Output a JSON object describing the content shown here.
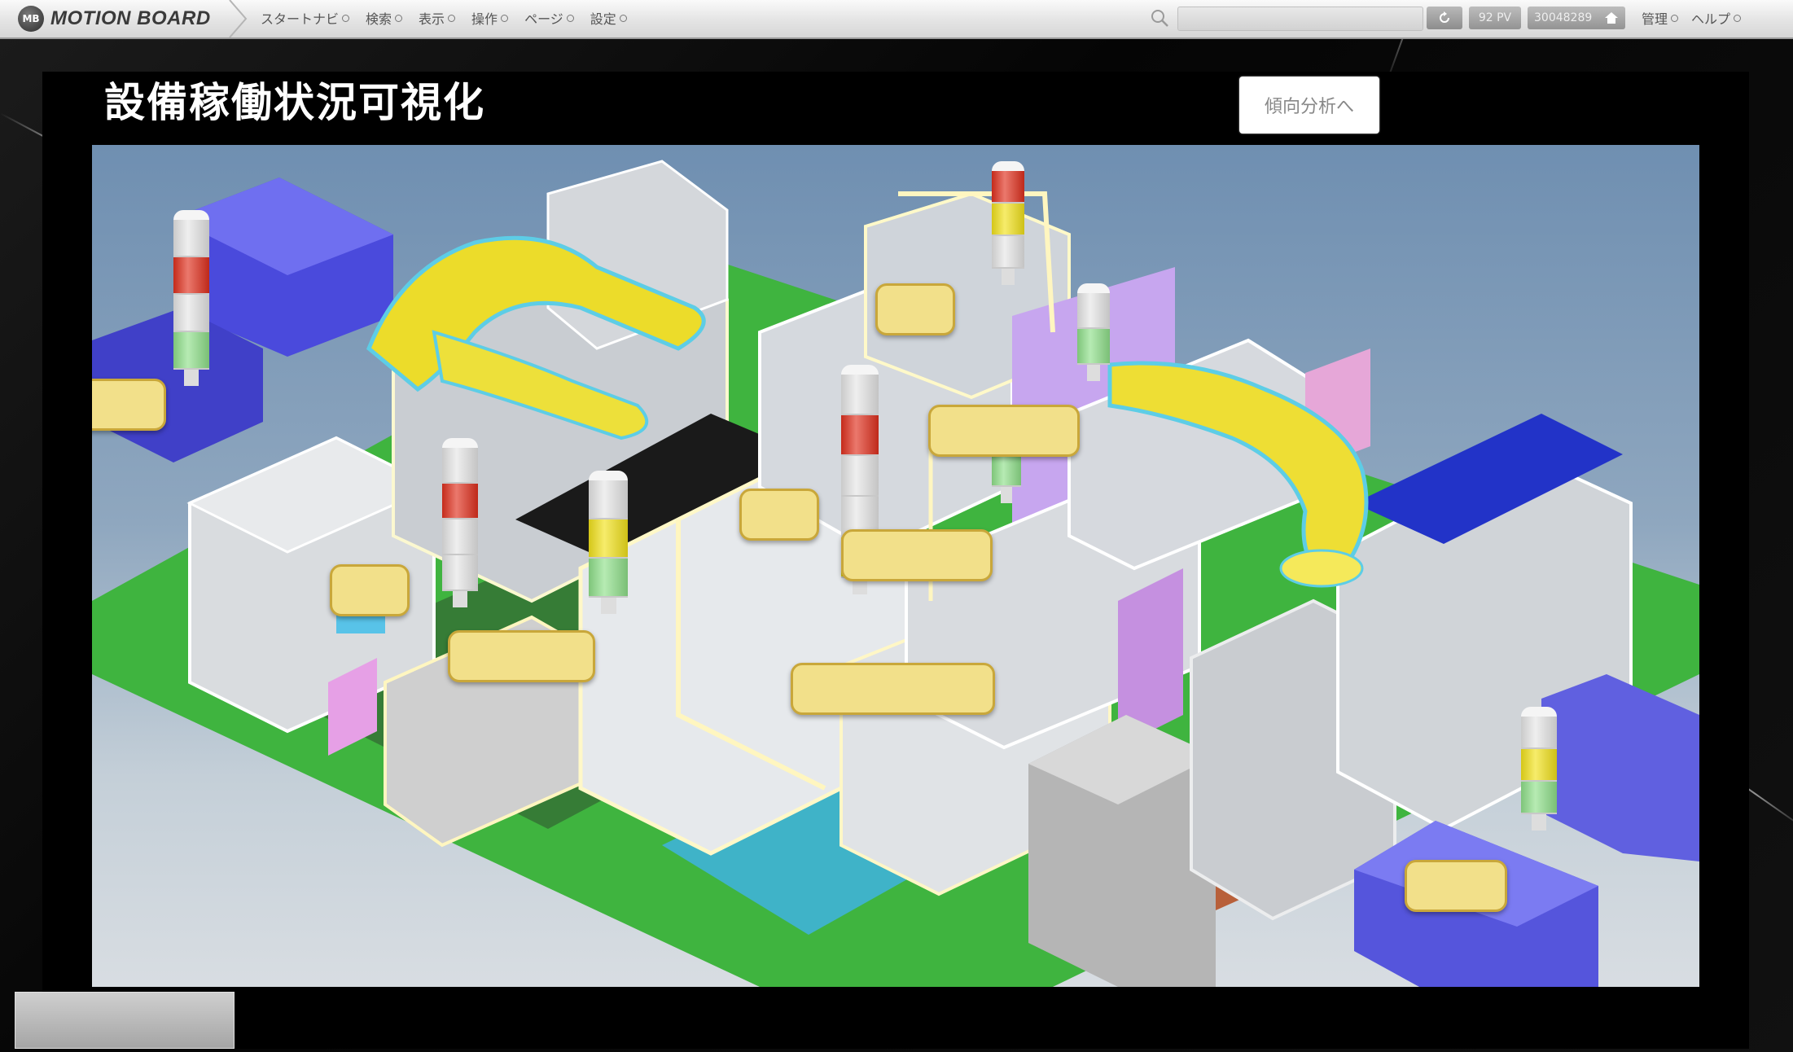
{
  "app": {
    "brand": "MotionBoard",
    "brand_display": "MOTION BOARD",
    "logo_letters": "MB"
  },
  "menu": [
    {
      "label": "スタートナビ"
    },
    {
      "label": "検索"
    },
    {
      "label": "表示"
    },
    {
      "label": "操作"
    },
    {
      "label": "ページ"
    },
    {
      "label": "設定"
    }
  ],
  "toolbar": {
    "pv_label": "92 PV",
    "user_id": "30048289"
  },
  "right_menu": [
    {
      "label": "管理"
    },
    {
      "label": "ヘルプ"
    }
  ],
  "page": {
    "title": "設備稼働状況可視化",
    "trend_button": "傾向分析へ"
  },
  "signal_towers": [
    {
      "id": "tower-1",
      "lights": [
        "off",
        "red",
        "off",
        "green"
      ]
    },
    {
      "id": "tower-2",
      "lights": [
        "off",
        "red",
        "off",
        "off"
      ]
    },
    {
      "id": "tower-3",
      "lights": [
        "off",
        "yellow",
        "green"
      ]
    },
    {
      "id": "tower-4",
      "lights": [
        "red",
        "yellow",
        "off"
      ]
    },
    {
      "id": "tower-5",
      "lights": [
        "off",
        "red",
        "off",
        "off",
        "yellow"
      ]
    },
    {
      "id": "tower-6",
      "lights": [
        "red",
        "green"
      ]
    },
    {
      "id": "tower-7",
      "lights": [
        "off",
        "green"
      ]
    },
    {
      "id": "tower-8",
      "lights": [
        "off",
        "yellow",
        "green"
      ]
    }
  ],
  "colors": {
    "red": "#e0301e",
    "yellow": "#f2e21b",
    "green": "#8fe08a",
    "off": "#e6e6e6",
    "label": "#f2e08a",
    "floor_green": "#3fb43f"
  }
}
